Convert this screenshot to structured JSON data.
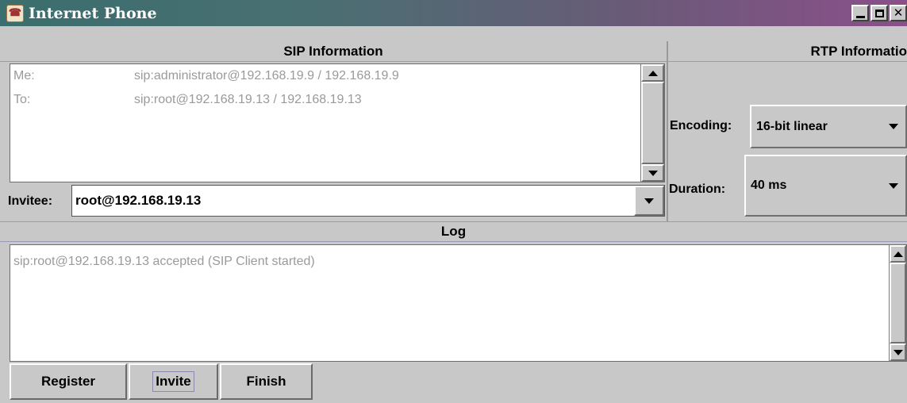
{
  "window": {
    "title": "Internet Phone"
  },
  "sip": {
    "header": "SIP Information",
    "me_label": "Me:",
    "me_value": "sip:administrator@192.168.19.9 / 192.168.19.9",
    "to_label": "To:",
    "to_value": "sip:root@192.168.19.13 / 192.168.19.13",
    "invitee_label": "Invitee:",
    "invitee_value": "root@192.168.19.13"
  },
  "rtp": {
    "header": "RTP Informatio",
    "encoding_label": "Encoding:",
    "encoding_value": "16-bit linear",
    "duration_label": "Duration:",
    "duration_value": "40 ms"
  },
  "log": {
    "header": "Log",
    "lines": [
      "sip:root@192.168.19.13 accepted (SIP Client started)"
    ]
  },
  "buttons": {
    "register": "Register",
    "invite": "Invite",
    "finish": "Finish"
  },
  "icons": {
    "app": "phone-app-icon",
    "minimize": "minimize-icon",
    "maximize": "maximize-icon",
    "close": "close-icon",
    "scroll_up": "arrow-up-icon",
    "scroll_down": "arrow-down-icon",
    "dropdown": "chevron-down-icon"
  }
}
